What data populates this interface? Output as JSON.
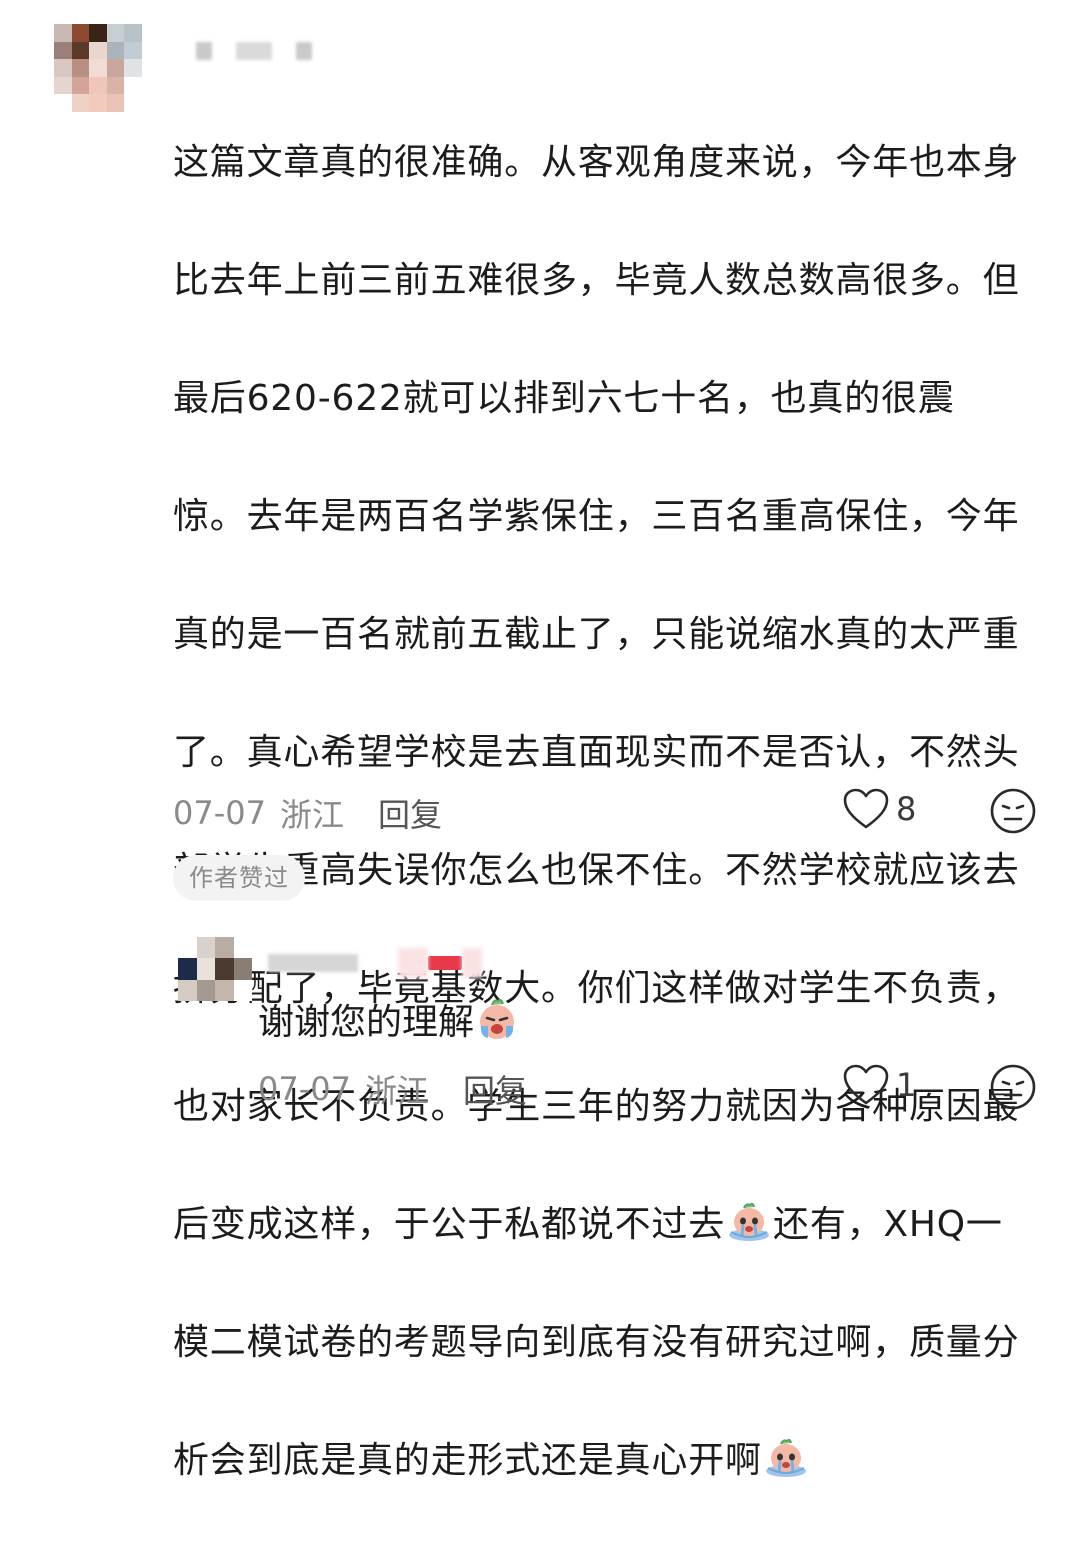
{
  "comment": {
    "avatar_icon": "pixelated-avatar",
    "username": "",
    "lines": [
      "这篇文章真的很准确。从客观角度来说，今年也本身",
      "比去年上前三前五难很多，毕竟人数总数高很多。但",
      "最后620-622就可以排到六七十名，也真的很震",
      "惊。去年是两百名学紫保住，三百名重高保住，今年",
      "真的是一百名就前五截止了，只能说缩水真的太严重",
      "了。真心希望学校是去直面现实而不是否认，不然头",
      "部学生重高失误你怎么也保不住。不然学校就应该去",
      "拼分配了，毕竟基数大。你们这样做对学生不负责，",
      "也对家长不负责。学生三年的努力就因为各种原因最"
    ],
    "line10_a": "后变成这样，于公于私都说不过去",
    "line10_b": "还有，XHQ一",
    "line11": "模二模试卷的考题导向到底有没有研究过啊，质量分",
    "line12": "析会到底是真的走形式还是真心开啊",
    "emoji_icon": "crying-emoji",
    "date": "07-07",
    "location": "浙江",
    "reply_label": "回复",
    "like_count": "8",
    "like_icon": "heart-icon",
    "dislike_icon": "unhappy-face-icon",
    "author_badge": "作者赞过"
  },
  "reply": {
    "avatar_icon": "pixelated-avatar",
    "username": "",
    "text": "谢谢您的理解",
    "emoji_icon": "crying-emoji",
    "date": "07-07",
    "location": "浙江",
    "reply_label": "回复",
    "like_count": "1"
  },
  "colors": {
    "text": "#1c1c1c",
    "meta": "#8a8a8a",
    "badge_bg": "#f3f3f3",
    "accent_red": "#e8394a"
  }
}
